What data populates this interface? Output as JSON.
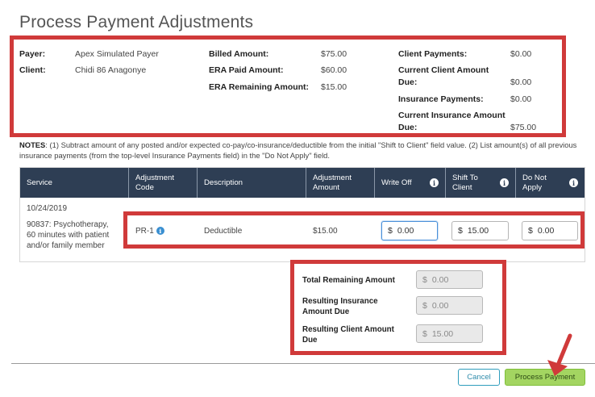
{
  "page": {
    "title": "Process Payment Adjustments"
  },
  "summary": {
    "payer_label": "Payer:",
    "payer_value": "Apex Simulated Payer",
    "client_label": "Client:",
    "client_value": "Chidi 86 Anagonye",
    "billed_label": "Billed Amount:",
    "billed_value": "$75.00",
    "era_paid_label": "ERA Paid Amount:",
    "era_paid_value": "$60.00",
    "era_remaining_label": "ERA Remaining Amount:",
    "era_remaining_value": "$15.00",
    "client_payments_label": "Client Payments:",
    "client_payments_value": "$0.00",
    "current_client_due_label_1": "Current Client Amount",
    "current_client_due_label_2": "Due:",
    "current_client_due_value": "$0.00",
    "insurance_payments_label": "Insurance Payments:",
    "insurance_payments_value": "$0.00",
    "current_insurance_due_label_1": "Current Insurance Amount",
    "current_insurance_due_label_2": "Due:",
    "current_insurance_due_value": "$75.00"
  },
  "notes": {
    "label": "NOTES",
    "text": ": (1) Subtract amount of any posted and/or expected co-pay/co-insurance/deductible from the initial \"Shift to Client\" field value. (2) List amount(s) of all previous insurance payments (from the top-level Insurance Payments field) in the \"Do Not Apply\" field."
  },
  "table": {
    "headers": {
      "service": "Service",
      "adj_code_1": "Adjustment",
      "adj_code_2": "Code",
      "description": "Description",
      "adj_amount_1": "Adjustment",
      "adj_amount_2": "Amount",
      "write_off": "Write Off",
      "shift_1": "Shift To",
      "shift_2": "Client",
      "dna_1": "Do Not",
      "dna_2": "Apply"
    },
    "row": {
      "date": "10/24/2019",
      "service_1": "90837: Psychotherapy,",
      "service_2": "60 minutes with patient",
      "service_3": "and/or family member",
      "adj_code": "PR-1",
      "description": "Deductible",
      "adj_amount": "$15.00",
      "write_off": "0.00",
      "shift_to_client": "15.00",
      "do_not_apply": "0.00"
    },
    "currency": "$",
    "info_glyph": "i"
  },
  "totals": {
    "remaining_label": "Total Remaining Amount",
    "remaining_value": "0.00",
    "ins_due_label_1": "Resulting Insurance",
    "ins_due_label_2": "Amount Due",
    "ins_due_value": "0.00",
    "client_due_label_1": "Resulting Client Amount",
    "client_due_label_2": "Due",
    "client_due_value": "15.00"
  },
  "actions": {
    "cancel": "Cancel",
    "process": "Process Payment"
  },
  "colors": {
    "highlight": "#d03a3a",
    "header": "#2e3e54",
    "primary_button": "#a3d561",
    "cancel_border": "#2f9dbd"
  }
}
